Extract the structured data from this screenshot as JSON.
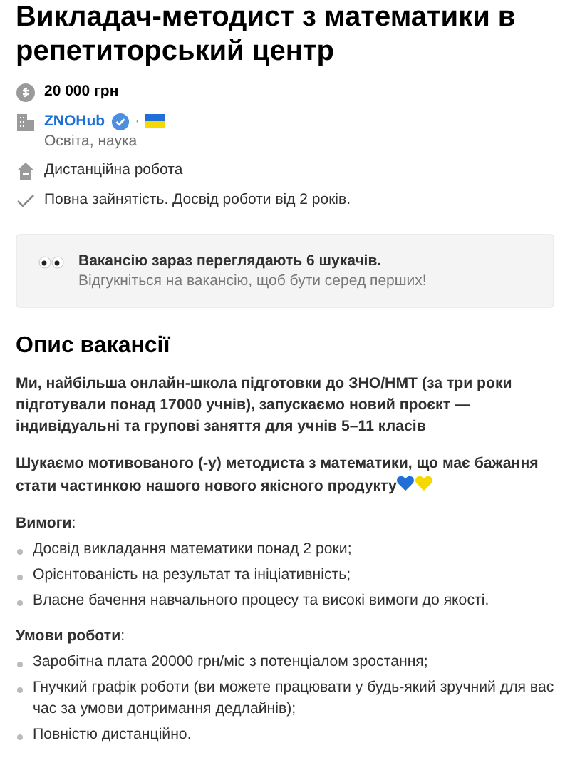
{
  "title": "Викладач-методист з математики в репетиторський центр",
  "facts": [
    {
      "kind": "salary",
      "text": "20 000 грн"
    },
    {
      "kind": "company",
      "text": "ZNOHub",
      "verified": true,
      "separator": "·",
      "sub": "Освіта, наука"
    },
    {
      "kind": "remote",
      "text": "Дистанційна робота"
    },
    {
      "kind": "check",
      "text": "Повна зайнятість. Досвід роботи від 2 років."
    }
  ],
  "notice": {
    "title": "Вакансію зараз переглядають 6 шукачів.",
    "text": "Відгукніться на вакансію, щоб бути серед перших!"
  },
  "description": {
    "heading": "Опис вакансії",
    "blocks": [
      {
        "kind": "bold",
        "text": "Ми, найбільша онлайн-школа підготовки до ЗНО/НМТ (за три роки підготували понад 17000 учнів), запускаємо новий проєкт — індивідуальні та групові заняття для учнів 5–11 класів"
      },
      {
        "kind": "bold",
        "text": "Шукаємо мотивованого (-у) методиста з математики, що має бажання стати частинкою нашого нового якісного продукту",
        "hearts": [
          {
            "color": "#1f6fd6"
          },
          {
            "color": "#f5d800"
          }
        ]
      },
      {
        "kind": "heading",
        "text": "**Вимоги**:"
      },
      {
        "kind": "list",
        "items": [
          "Досвід викладання математики понад 2 роки;",
          "Орієнтованість на результат та ініціативність;",
          "Власне бачення навчального процесу та високі вимоги до якості."
        ]
      },
      {
        "kind": "heading",
        "text": "**Умови роботи**:"
      },
      {
        "kind": "list",
        "items": [
          "Заробітна плата 20000 грн/міс з потенціалом зростання;",
          "Гнучкий графік роботи (ви можете працювати у будь-який зручний для вас час за умови дотримання дедлайнів);",
          "Повністю дистанційно."
        ]
      }
    ]
  }
}
